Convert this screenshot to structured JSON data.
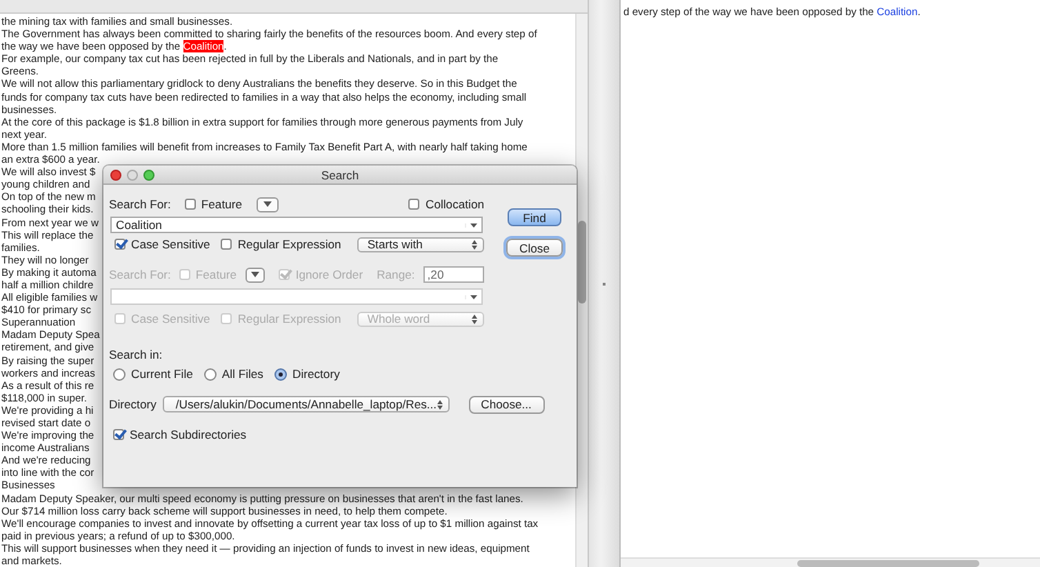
{
  "left_pane": {
    "lines": [
      {
        "text": "the mining tax with families and small businesses."
      },
      {
        "text": "The Government has always been committed to sharing fairly the benefits of the resources boom. And every step of"
      },
      {
        "text": "the way we have been opposed by the ",
        "match": "Coalition",
        "after": "."
      },
      {
        "text": "For example, our company tax cut has been rejected in full by the Liberals and Nationals, and in part by the"
      },
      {
        "text": "Greens."
      },
      {
        "text": "We will not allow this parliamentary gridlock to deny Australians the benefits they deserve. So in this Budget the"
      },
      {
        "text": "funds for company tax cuts have been redirected to families in a way that also helps the economy, including small"
      },
      {
        "text": "businesses."
      },
      {
        "text": "At the core of this package is $1.8 billion in extra support for families through more generous payments from July"
      },
      {
        "text": "next year."
      },
      {
        "text": "More than 1.5 million families will benefit from increases to Family Tax Benefit Part A, with nearly half taking home"
      },
      {
        "text": "an extra $600 a year."
      },
      {
        "text": "We will also invest $"
      },
      {
        "text": "young children and"
      },
      {
        "text": "On top of the new m"
      },
      {
        "text": "schooling their kids."
      },
      {
        "text": "From next year we w"
      },
      {
        "text": "This will replace the"
      },
      {
        "text": "families."
      },
      {
        "text": "They will no longer"
      },
      {
        "text": "By making it automa"
      },
      {
        "text": "half a million childre"
      },
      {
        "text": "All eligible families w"
      },
      {
        "text": "$410 for primary sc"
      },
      {
        "text": "Superannuation"
      },
      {
        "text": "Madam Deputy Spea"
      },
      {
        "text": "retirement, and give"
      },
      {
        "text": "By raising the super"
      },
      {
        "text": "workers and increas"
      },
      {
        "text": "As a result of this re"
      },
      {
        "text": "$118,000 in super."
      },
      {
        "text": "We're providing a hi"
      },
      {
        "text": "revised start date o"
      },
      {
        "text": "We're improving the"
      },
      {
        "text": "income Australians"
      },
      {
        "text": "And we're reducing"
      },
      {
        "text": "into line with the cor"
      },
      {
        "text": "Businesses"
      },
      {
        "text": "Madam Deputy Speaker, our multi speed economy is putting pressure on businesses that aren't in the fast lanes."
      },
      {
        "text": "Our $714 million loss carry back scheme will support businesses in need, to help them compete."
      },
      {
        "text": "We'll encourage companies to invest and innovate by offsetting a current year tax loss of up to $1 million against tax"
      },
      {
        "text": "paid in previous years; a refund of up to $300,000."
      },
      {
        "text": "This will support businesses when they need it — providing an injection of funds to invest in new ideas, equipment"
      },
      {
        "text": "and markets."
      }
    ]
  },
  "right_pane": {
    "lines": [
      {
        "text": "d every step of the way we have been opposed by the ",
        "match": "Coalition",
        "after": "."
      }
    ]
  },
  "dialog": {
    "title": "Search",
    "primary": {
      "label": "Search For:",
      "feature": {
        "label": "Feature",
        "checked": false
      },
      "collocation": {
        "label": "Collocation",
        "checked": false
      },
      "query": "Coalition",
      "case_sensitive": {
        "label": "Case Sensitive",
        "checked": true
      },
      "regex": {
        "label": "Regular Expression",
        "checked": false
      },
      "mode": "Starts with"
    },
    "secondary": {
      "disabled": true,
      "label": "Search For:",
      "feature": {
        "label": "Feature",
        "checked": false
      },
      "ignore_order": {
        "label": "Ignore Order",
        "checked": true
      },
      "range_label": "Range:",
      "range": ",20",
      "case_sensitive": {
        "label": "Case Sensitive",
        "checked": false
      },
      "regex": {
        "label": "Regular Expression",
        "checked": false
      },
      "mode": "Whole word"
    },
    "search_in": {
      "label": "Search in:",
      "options": [
        {
          "label": "Current File",
          "selected": false
        },
        {
          "label": "All Files",
          "selected": false
        },
        {
          "label": "Directory",
          "selected": true
        }
      ]
    },
    "directory": {
      "label": "Directory",
      "path": "/Users/alukin/Documents/Annabelle_laptop/Res...",
      "choose": "Choose..."
    },
    "subdirectories": {
      "label": "Search Subdirectories",
      "checked": true
    },
    "buttons": [
      {
        "label": "Find",
        "default": true
      },
      {
        "label": "Close",
        "default": false
      }
    ]
  }
}
